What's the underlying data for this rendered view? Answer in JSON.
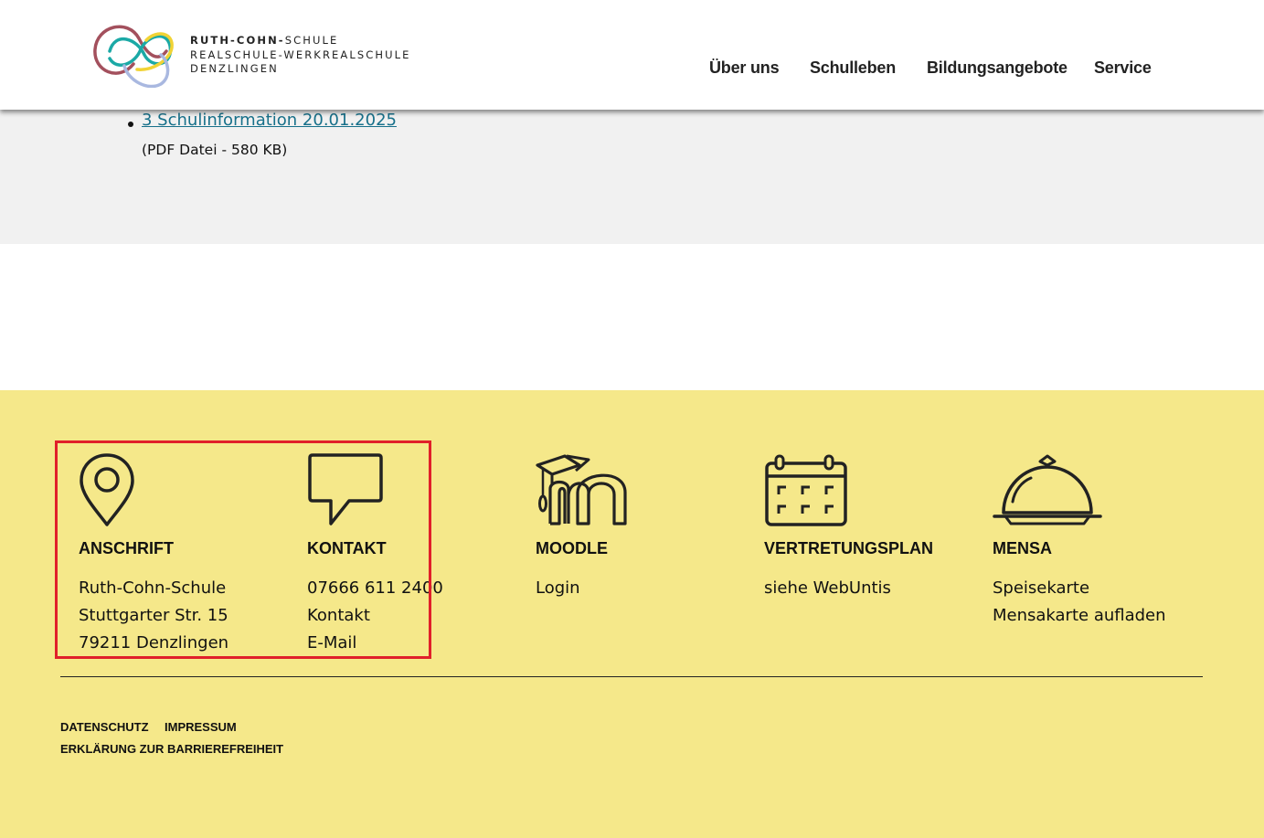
{
  "header": {
    "logo_line1_bold": "RUTH-COHN-",
    "logo_line1_rest": "SCHULE",
    "logo_line2": "REALSCHULE-WERKREALSCHULE",
    "logo_line3": "DENZLINGEN",
    "nav": [
      "Über uns",
      "Schulleben",
      "Bildungsangebote",
      "Service"
    ]
  },
  "content": {
    "document": {
      "link": "3 Schulinformation 20.01.2025",
      "meta": "(PDF Datei - 580 KB)"
    }
  },
  "footer": {
    "columns": [
      {
        "icon": "location-pin-icon",
        "title": "ANSCHRIFT",
        "lines": [
          "Ruth-Cohn-Schule",
          "Stuttgarter Str. 15",
          "79211 Denzlingen"
        ]
      },
      {
        "icon": "speech-bubble-icon",
        "title": "KONTAKT",
        "lines": [
          "07666 611 2400",
          "Kontakt",
          "E-Mail"
        ]
      },
      {
        "icon": "moodle-icon",
        "title": "MOODLE",
        "lines": [
          "Login"
        ]
      },
      {
        "icon": "calendar-icon",
        "title": "VERTRETUNGSPLAN",
        "lines": [
          "siehe WebUntis"
        ]
      },
      {
        "icon": "cloche-icon",
        "title": "MENSA",
        "lines": [
          "Speisekarte",
          "Mensakarte aufladen"
        ]
      }
    ],
    "legal": [
      "DATENSCHUTZ",
      "IMPRESSUM",
      "ERKLÄRUNG ZUR BARRIEREFREIHEIT"
    ]
  },
  "colors": {
    "footer_bg": "#f5e88a",
    "link": "#17708a",
    "highlight": "#e0202a",
    "logo_red": "#a3505d",
    "logo_teal": "#1ba9a6",
    "logo_yellow": "#f1d335",
    "logo_blue": "#a9b8e0"
  }
}
